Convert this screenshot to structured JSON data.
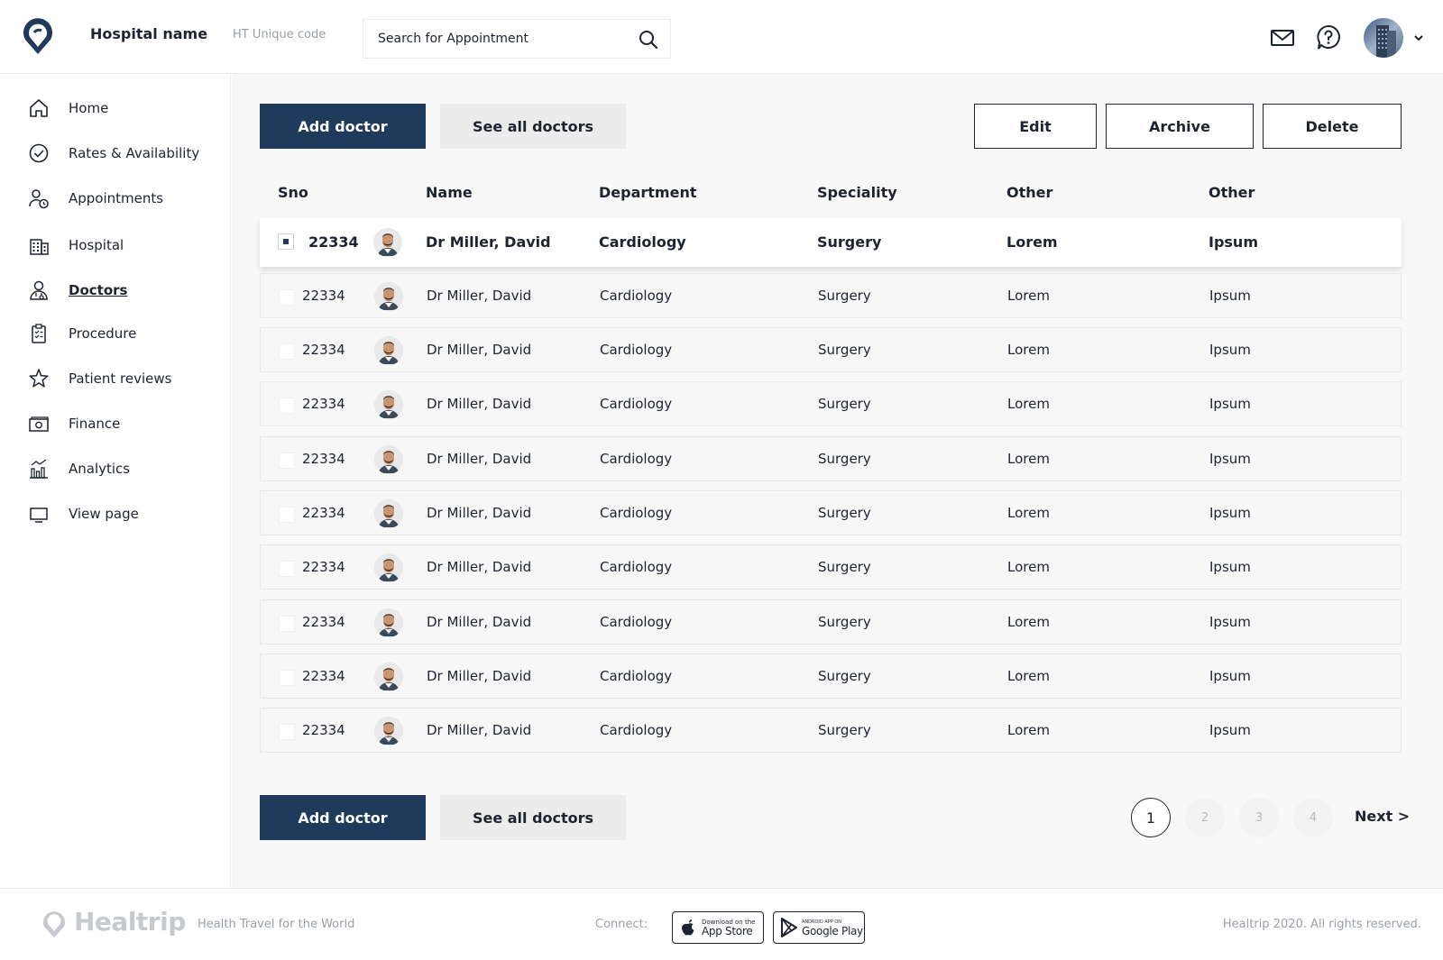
{
  "header": {
    "hospital_name": "Hospital name",
    "unique_code": "HT Unique code",
    "search_placeholder": "Search for Appointment",
    "icons": [
      "logo-icon",
      "search-icon",
      "mail-icon",
      "help-icon",
      "chevron-down-icon"
    ]
  },
  "sidebar": {
    "items": [
      {
        "label": "Home",
        "icon": "home-icon"
      },
      {
        "label": "Rates & Availability",
        "icon": "check-circle-icon"
      },
      {
        "label": "Appointments",
        "icon": "user-clock-icon"
      },
      {
        "label": "Hospital",
        "icon": "building-icon"
      },
      {
        "label": "Doctors",
        "icon": "doctor-icon",
        "active": true
      },
      {
        "label": "Procedure",
        "icon": "clipboard-icon"
      },
      {
        "label": "Patient reviews",
        "icon": "star-icon"
      },
      {
        "label": "Finance",
        "icon": "money-icon"
      },
      {
        "label": "Analytics",
        "icon": "analytics-icon"
      },
      {
        "label": "View page",
        "icon": "monitor-icon"
      }
    ]
  },
  "toolbar": {
    "add_doctor": "Add doctor",
    "see_all_doctors": "See all doctors",
    "edit": "Edit",
    "archive": "Archive",
    "delete": "Delete"
  },
  "table": {
    "headers": [
      "Sno",
      "Name",
      "Department",
      "Speciality",
      "Other",
      "Other"
    ],
    "rows": [
      {
        "sno": "22334",
        "name": "Dr Miller, David",
        "department": "Cardiology",
        "speciality": "Surgery",
        "other1": "Lorem",
        "other2": "Ipsum",
        "selected": true
      },
      {
        "sno": "22334",
        "name": "Dr Miller, David",
        "department": "Cardiology",
        "speciality": "Surgery",
        "other1": "Lorem",
        "other2": "Ipsum"
      },
      {
        "sno": "22334",
        "name": "Dr Miller, David",
        "department": "Cardiology",
        "speciality": "Surgery",
        "other1": "Lorem",
        "other2": "Ipsum"
      },
      {
        "sno": "22334",
        "name": "Dr Miller, David",
        "department": "Cardiology",
        "speciality": "Surgery",
        "other1": "Lorem",
        "other2": "Ipsum"
      },
      {
        "sno": "22334",
        "name": "Dr Miller, David",
        "department": "Cardiology",
        "speciality": "Surgery",
        "other1": "Lorem",
        "other2": "Ipsum"
      },
      {
        "sno": "22334",
        "name": "Dr Miller, David",
        "department": "Cardiology",
        "speciality": "Surgery",
        "other1": "Lorem",
        "other2": "Ipsum"
      },
      {
        "sno": "22334",
        "name": "Dr Miller, David",
        "department": "Cardiology",
        "speciality": "Surgery",
        "other1": "Lorem",
        "other2": "Ipsum"
      },
      {
        "sno": "22334",
        "name": "Dr Miller, David",
        "department": "Cardiology",
        "speciality": "Surgery",
        "other1": "Lorem",
        "other2": "Ipsum"
      },
      {
        "sno": "22334",
        "name": "Dr Miller, David",
        "department": "Cardiology",
        "speciality": "Surgery",
        "other1": "Lorem",
        "other2": "Ipsum"
      },
      {
        "sno": "22334",
        "name": "Dr Miller, David",
        "department": "Cardiology",
        "speciality": "Surgery",
        "other1": "Lorem",
        "other2": "Ipsum"
      }
    ]
  },
  "pagination": {
    "pages": [
      "1",
      "2",
      "3",
      "4"
    ],
    "current": "1",
    "next": "Next >"
  },
  "footer": {
    "brand": "Healtrip",
    "tagline": "Health Travel for the World",
    "connect": "Connect:",
    "app_store_small": "Download on the",
    "app_store_big": "App Store",
    "google_play_small": "ANDROID APP ON",
    "google_play_big": "Google Play",
    "copyright": "Healtrip 2020. All rights reserved."
  },
  "colors": {
    "primary": "#1f3a5a",
    "secondary_button": "#ececec",
    "text": "#1d2330",
    "muted": "#9aa0a8"
  }
}
